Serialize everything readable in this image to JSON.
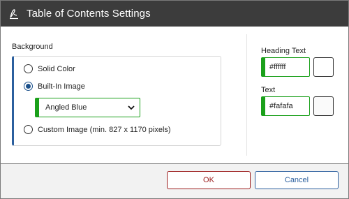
{
  "window": {
    "title": "Table of Contents Settings",
    "icon": "signature-pen-icon"
  },
  "background": {
    "label": "Background",
    "options": [
      {
        "label": "Solid Color",
        "checked": false
      },
      {
        "label": "Built-In Image",
        "checked": true
      },
      {
        "label": "Custom Image (min. 827 x 1170 pixels)",
        "checked": false
      }
    ],
    "builtin_select": {
      "value": "Angled Blue"
    }
  },
  "heading_text": {
    "label": "Heading Text",
    "value": "#ffffff",
    "swatch_color": "#ffffff"
  },
  "text": {
    "label": "Text",
    "value": "#fafafa",
    "swatch_color": "#fafafa"
  },
  "buttons": {
    "ok": "OK",
    "cancel": "Cancel"
  },
  "colors": {
    "titlebar": "#3c3c3c",
    "accent_green": "#1aa01a",
    "accent_blue": "#2b5f9e",
    "ok_red": "#9b1c1c"
  }
}
